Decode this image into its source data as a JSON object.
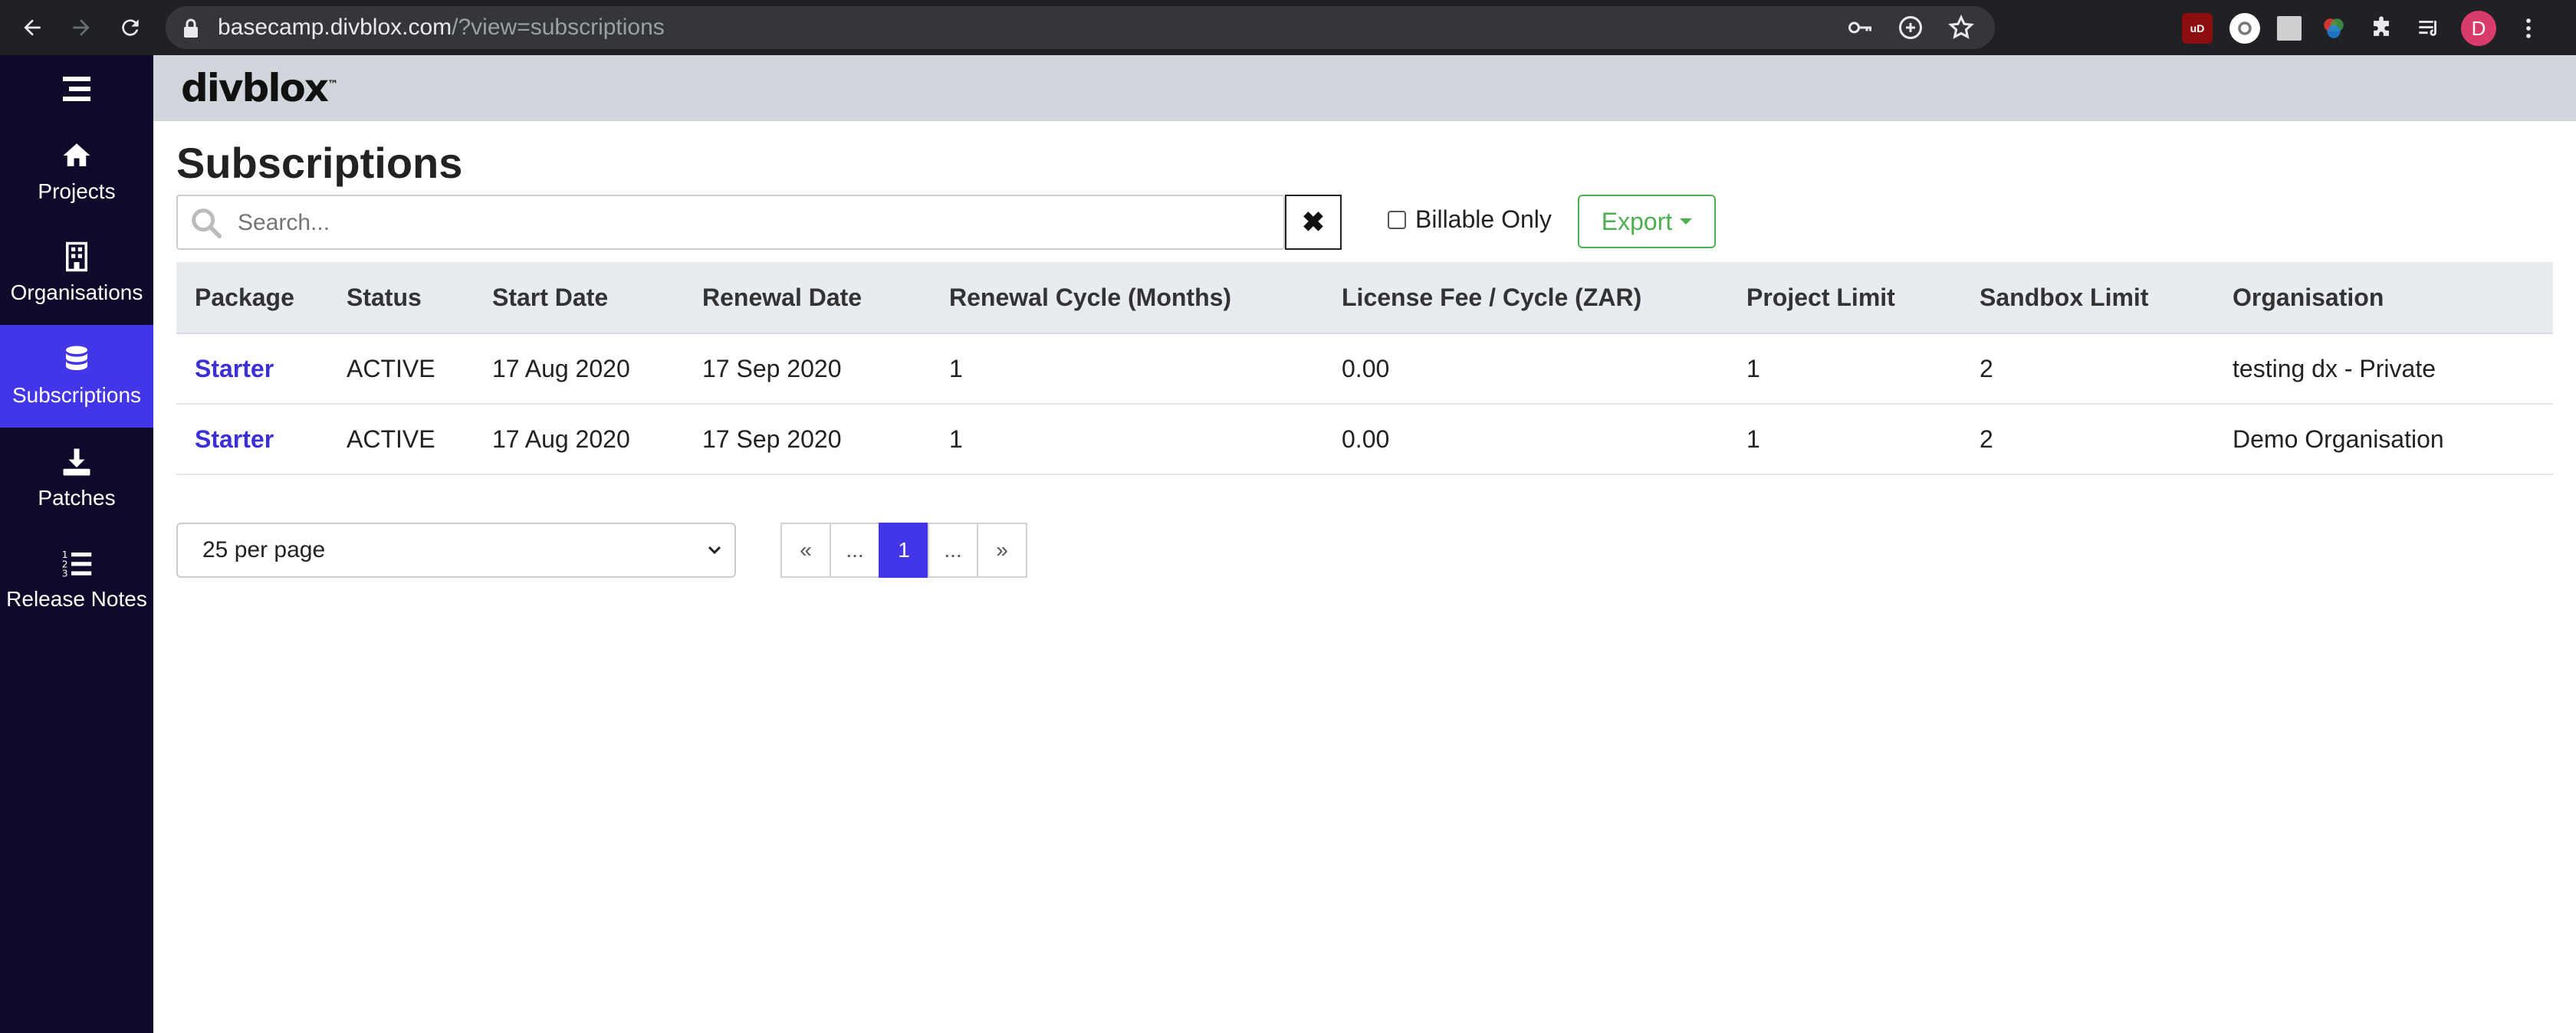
{
  "browser": {
    "url_host": "basecamp.divblox.com",
    "url_path": "/?view=subscriptions",
    "avatar_letter": "D"
  },
  "sidebar": {
    "items": [
      {
        "label": "Projects",
        "icon": "home-icon"
      },
      {
        "label": "Organisations",
        "icon": "building-icon"
      },
      {
        "label": "Subscriptions",
        "icon": "database-icon",
        "active": true
      },
      {
        "label": "Patches",
        "icon": "download-icon"
      },
      {
        "label": "Release Notes",
        "icon": "list-ol-icon"
      }
    ]
  },
  "header": {
    "logo_text": "divblox",
    "logo_tm": "™"
  },
  "main": {
    "title": "Subscriptions",
    "search_placeholder": "Search...",
    "clear_label": "✖",
    "billable_label": "Billable Only",
    "export_label": "Export"
  },
  "table": {
    "headers": [
      "Package",
      "Status",
      "Start Date",
      "Renewal Date",
      "Renewal Cycle (Months)",
      "License Fee / Cycle (ZAR)",
      "Project Limit",
      "Sandbox Limit",
      "Organisation"
    ],
    "rows": [
      [
        "Starter",
        "ACTIVE",
        "17 Aug 2020",
        "17 Sep 2020",
        "1",
        "0.00",
        "1",
        "2",
        "testing dx - Private"
      ],
      [
        "Starter",
        "ACTIVE",
        "17 Aug 2020",
        "17 Sep 2020",
        "1",
        "0.00",
        "1",
        "2",
        "Demo Organisation"
      ]
    ]
  },
  "pagination": {
    "per_page": "25 per page",
    "first": "«",
    "prev_ellipsis": "...",
    "current": "1",
    "next_ellipsis": "...",
    "last": "»"
  },
  "colors": {
    "sidebar_bg": "#0e0a2a",
    "accent": "#4335e8",
    "export_green": "#4caf50"
  }
}
